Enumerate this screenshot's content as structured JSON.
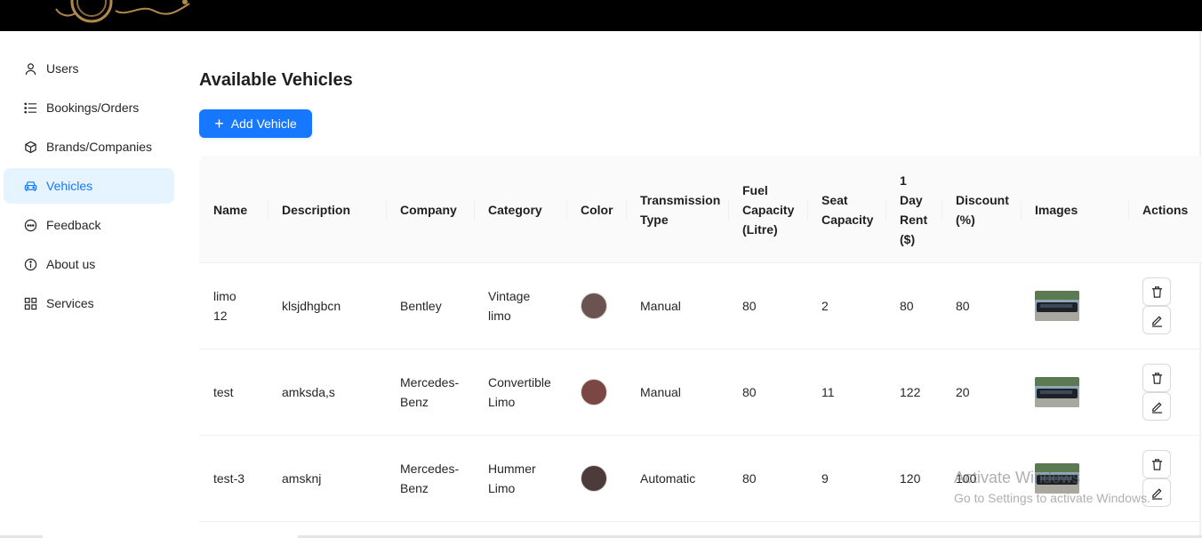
{
  "nav": {
    "items": [
      {
        "label": "Users",
        "icon": "user-icon"
      },
      {
        "label": "Bookings/Orders",
        "icon": "list-icon"
      },
      {
        "label": "Brands/Companies",
        "icon": "cube-icon"
      },
      {
        "label": "Vehicles",
        "icon": "car-icon",
        "active": true
      },
      {
        "label": "Feedback",
        "icon": "message-icon"
      },
      {
        "label": "About us",
        "icon": "info-icon"
      },
      {
        "label": "Services",
        "icon": "grid-icon"
      }
    ]
  },
  "main": {
    "title": "Available Vehicles",
    "add_button": "Add Vehicle"
  },
  "table": {
    "headers": [
      "Name",
      "Description",
      "Company",
      "Category",
      "Color",
      "Transmission Type",
      "Fuel Capacity (Litre)",
      "Seat Capacity",
      "1 Day Rent ($)",
      "Discount (%)",
      "Images",
      "Actions"
    ],
    "rows": [
      {
        "name": "limo 12",
        "description": "klsjdhgbcn",
        "company": "Bentley",
        "category": "Vintage limo",
        "color": "#6b5352",
        "transmission": "Manual",
        "fuel": "80",
        "seats": "2",
        "rent": "80",
        "discount": "80"
      },
      {
        "name": "test",
        "description": "amksda,s",
        "company": "Mercedes-Benz",
        "category": "Convertible Limo",
        "color": "#7a4745",
        "transmission": "Manual",
        "fuel": "80",
        "seats": "11",
        "rent": "122",
        "discount": "20"
      },
      {
        "name": "test-3",
        "description": "amsknj",
        "company": "Mercedes-Benz",
        "category": "Hummer Limo",
        "color": "#4d3b3b",
        "transmission": "Automatic",
        "fuel": "80",
        "seats": "9",
        "rent": "120",
        "discount": "100"
      }
    ]
  },
  "watermark": {
    "line1": "Activate Windows",
    "line2": "Go to Settings to activate Windows."
  },
  "colors": {
    "accent": "#1677ff",
    "active_bg": "#e6f4ff"
  }
}
